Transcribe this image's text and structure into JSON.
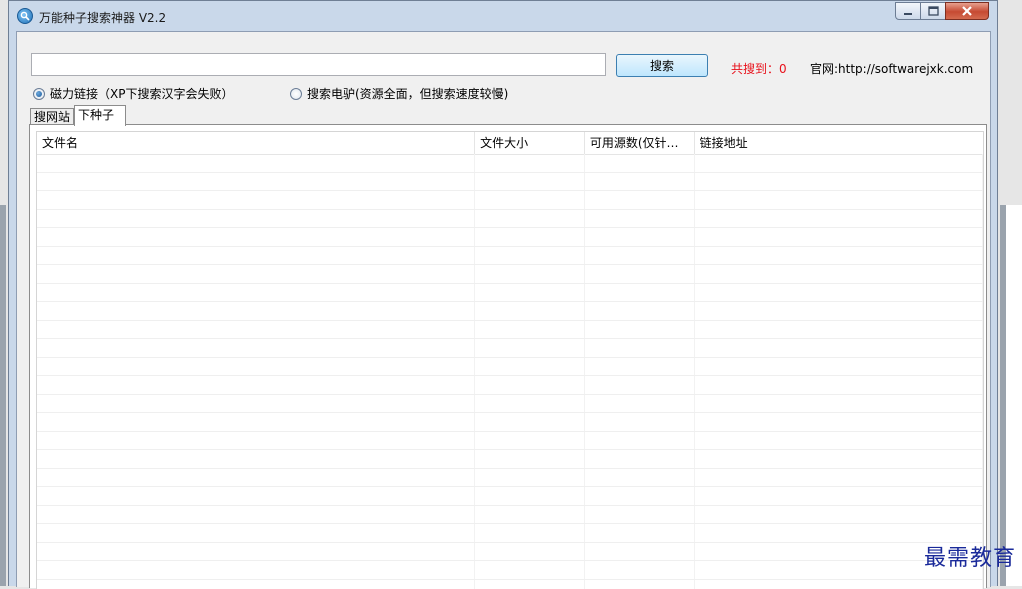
{
  "window": {
    "title": "万能种子搜索神器 V2.2",
    "controls": [
      "minimize-icon",
      "maximize-icon",
      "close-icon"
    ]
  },
  "search": {
    "value": "",
    "placeholder": "",
    "button_label": "搜索",
    "count_text": "共搜到：0",
    "website": "官网:http://softwarejxk.com"
  },
  "options": {
    "magnet_label": "磁力链接（XP下搜索汉字会失败）",
    "ed2k_label": "搜索电驴(资源全面，但搜索速度较慢)",
    "selected": "magnet"
  },
  "tabs": [
    {
      "label": "搜网站",
      "active": false
    },
    {
      "label": "下种子",
      "active": true
    }
  ],
  "table": {
    "columns": [
      "文件名",
      "文件大小",
      "可用源数(仅针…",
      "链接地址"
    ],
    "rows": []
  },
  "watermark": "最需教育",
  "colors": {
    "count_text": "#e8101a",
    "titlebar": "#c9d8ea",
    "close_button": "#c64a32"
  }
}
